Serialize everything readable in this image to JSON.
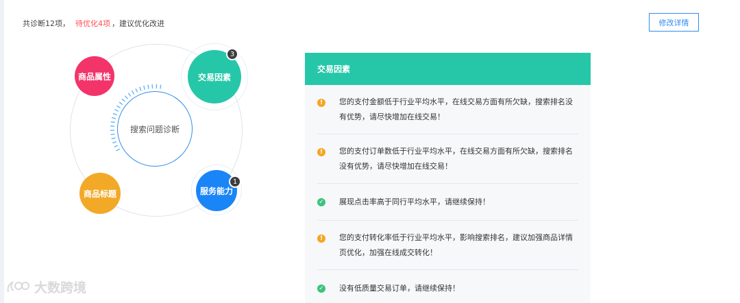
{
  "summary": {
    "total": "共诊断12项，",
    "pending": "待优化4项",
    "suffix": "，建议优化改进"
  },
  "edit_button": "修改详情",
  "diagram": {
    "center_label": "搜索问题诊断",
    "nodes": [
      {
        "label": "商品属性",
        "color": "#f2346a"
      },
      {
        "label": "交易因素",
        "color": "#26c7a9",
        "badge": "3"
      },
      {
        "label": "商品标题",
        "color": "#f2a928"
      },
      {
        "label": "服务能力",
        "color": "#1a85f7",
        "badge": "1"
      }
    ]
  },
  "panel": {
    "title": "交易因素",
    "items": [
      {
        "status": "warning",
        "icon": "warning-icon",
        "text": "您的支付金额低于行业平均水平，在线交易方面有所欠缺，搜索排名没有优势，请尽快增加在线交易！"
      },
      {
        "status": "warning",
        "icon": "warning-icon",
        "text": "您的支付订单数低于行业平均水平，在线交易方面有所欠缺，搜索排名没有优势，请尽快增加在线交易！"
      },
      {
        "status": "ok",
        "icon": "check-icon",
        "text": "展现点击率高于同行平均水平，请继续保持！"
      },
      {
        "status": "warning",
        "icon": "warning-icon",
        "text": "您的支付转化率低于行业平均水平，影响搜索排名，建议加强商品详情页优化，加强在线成交转化！"
      },
      {
        "status": "ok",
        "icon": "check-icon",
        "text": "没有低质量交易订单，请继续保持！"
      }
    ]
  },
  "watermark": "大数跨境",
  "colors": {
    "accent": "#2d8cf0",
    "warning": "#f5a623",
    "ok": "#3cc47c",
    "panel_header": "#26c7a9",
    "highlight": "#ff4d4f"
  }
}
